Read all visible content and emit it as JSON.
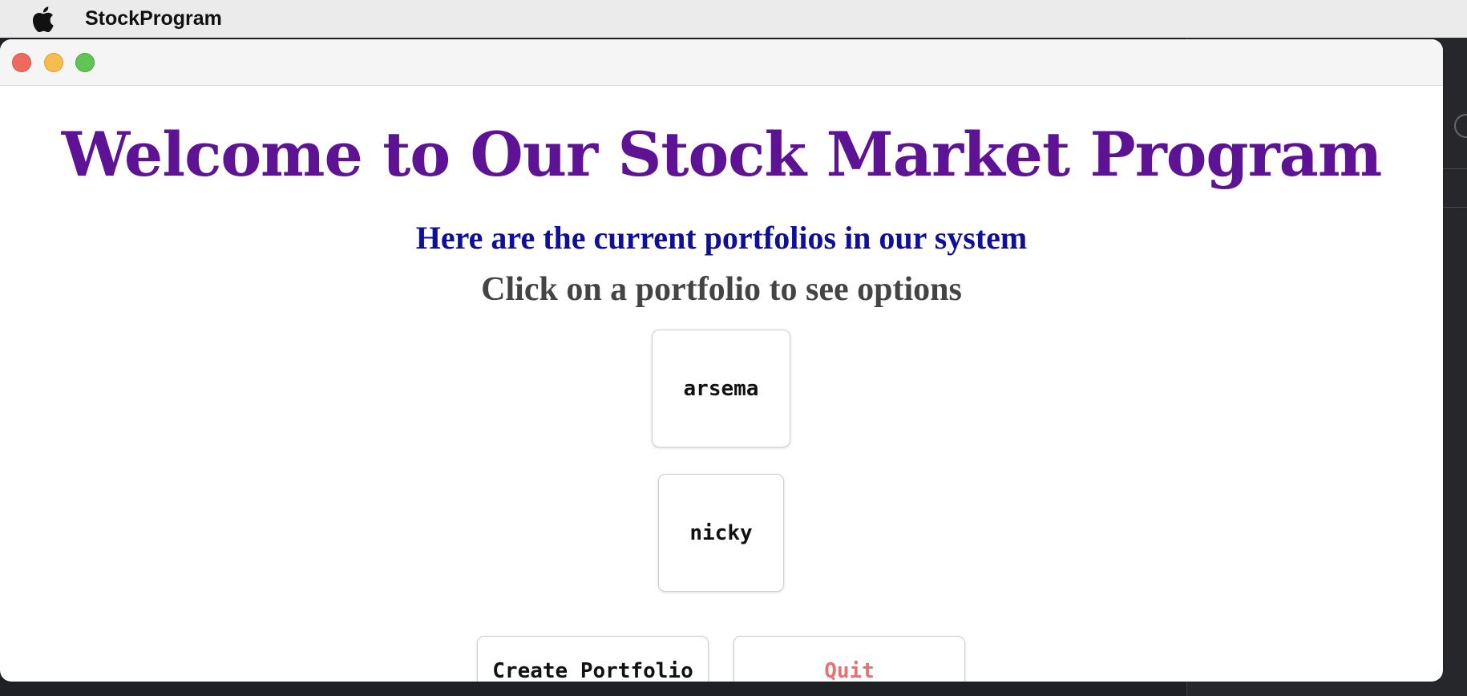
{
  "menubar": {
    "apple_icon": "apple-logo",
    "app_name": "StockProgram"
  },
  "window": {
    "traffic_lights": {
      "close_color": "#ee6a5e",
      "minimize_color": "#f5bd4f",
      "zoom_color": "#61c454"
    }
  },
  "main": {
    "title": "Welcome to Our Stock Market Program",
    "subtitle": "Here are the current portfolios in our system",
    "instruction": "Click on a portfolio to see options",
    "portfolios": [
      {
        "label": "arsema"
      },
      {
        "label": "nicky"
      }
    ],
    "actions": {
      "create_label": "Create Portfolio",
      "quit_label": "Quit"
    }
  },
  "colors": {
    "title": "#5e1294",
    "subtitle": "#0f0f98",
    "instruction": "#444444",
    "quit_text": "#e57373"
  }
}
